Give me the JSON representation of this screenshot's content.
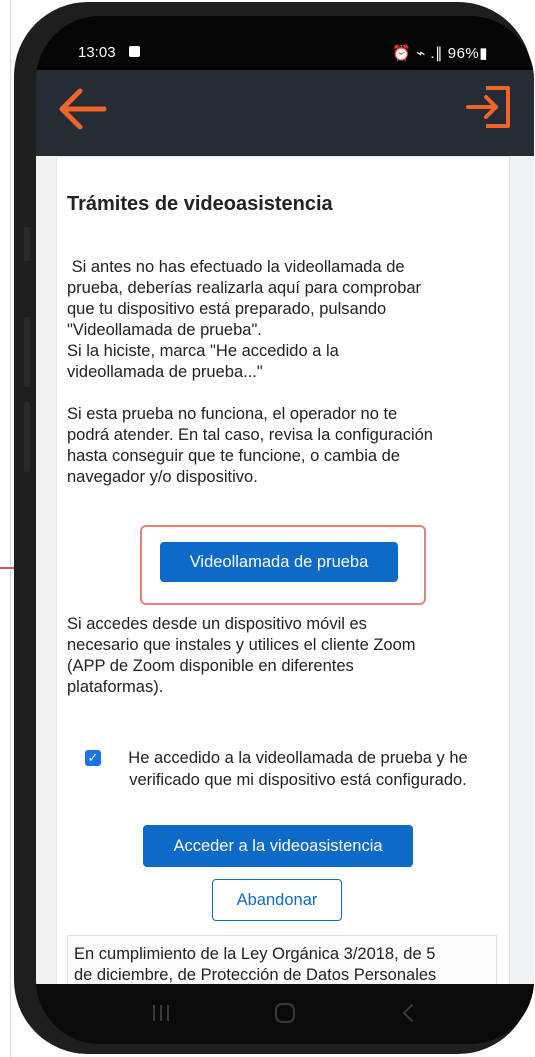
{
  "status": {
    "time": "13:03",
    "right": "⏰ ⌁ .∥ 96%▮"
  },
  "header": {
    "back_icon": "arrow-left-icon",
    "exit_icon": "exit-icon",
    "accent": "#f0652a",
    "bg": "#252c34"
  },
  "card": {
    "title": "Trámites de videoasistencia",
    "intro_lines": [
      " Si antes no has efectuado la videollamada de",
      "prueba, deberías realizarla aquí para comprobar",
      "que tu dispositivo está preparado, pulsando",
      "\"Videollamada de prueba\".",
      "Si la hiciste, marca \"He accedido a la",
      "videollamada de prueba...\""
    ],
    "warning_lines": [
      "Si esta prueba no funciona, el operador no te",
      "podrá atender. En tal caso, revisa la configuración",
      "hasta conseguir que te funcione, o cambia de",
      "navegador y/o dispositivo."
    ],
    "test_button": "Videollamada de prueba",
    "mobile_lines": [
      "Si accedes desde un dispositivo móvil es",
      "necesario que instales y utilices el cliente Zoom",
      "(APP de Zoom disponible en diferentes",
      "plataformas)."
    ],
    "checkbox_lines": [
      "He accedido a la videollamada de prueba y he",
      "verificado que mi dispositivo está configurado."
    ],
    "checkbox_checked": true,
    "access_button": "Acceder a la videoasistencia",
    "abandon_button": "Abandonar",
    "legal_lines": [
      "En cumplimiento de la Ley Orgánica 3/2018, de 5",
      "de diciembre, de Protección de Datos Personales"
    ]
  },
  "colors": {
    "primary": "#0d6ac7",
    "highlight": "#e0857c"
  }
}
